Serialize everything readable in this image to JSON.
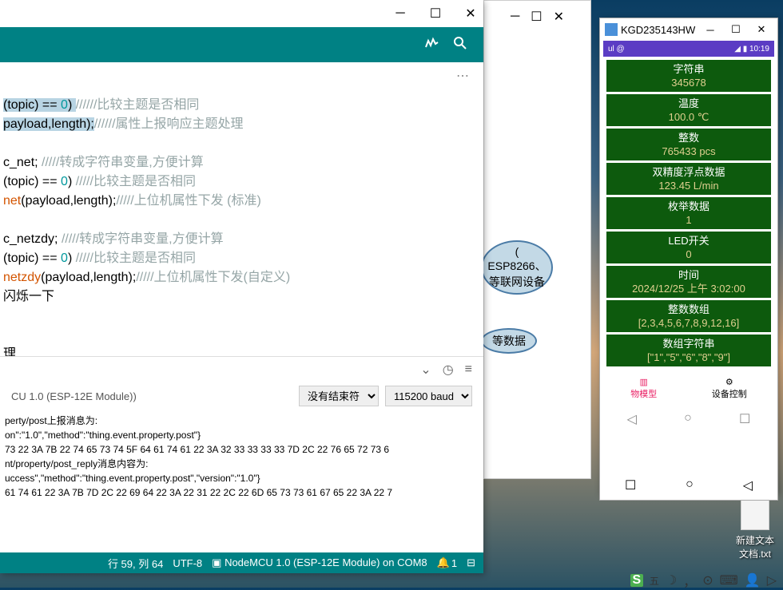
{
  "arduino": {
    "code": {
      "l1_a": "(topic) == ",
      "l1_b": "0",
      "l1_c": ") ",
      "l1_d": "//////比较主题是否相同",
      "l2_a": "payload,length);",
      "l2_b": "//////属性上报响应主题处理",
      "l4_a": "c_net;          ",
      "l4_b": "/////转成字符串变量,方便计算",
      "l5_a": "(topic) == ",
      "l5_b": "0",
      "l5_c": ") ",
      "l5_d": "/////比较主题是否相同",
      "l6_a": "net",
      "l6_b": "(payload,length);",
      "l6_c": "/////上位机属性下发 (标准)",
      "l8_a": "c_netzdy; ",
      "l8_b": "/////转成字符串变量,方便计算",
      "l9_a": "(topic) == ",
      "l9_b": "0",
      "l9_c": ") ",
      "l9_d": "/////比较主题是否相同",
      "l10_a": "netzdy",
      "l10_b": "(payload,length);",
      "l10_c": "/////上位机属性下发(自定义)",
      "l11": "闪烁一下",
      "l13": "理"
    },
    "serial": {
      "module_label": "CU 1.0 (ESP-12E Module))",
      "terminator_label": "没有结束符",
      "baud_label": "115200 baud",
      "lines": [
        "perty/post上报消息为:",
        "on\":\"1.0\",\"method\":\"thing.event.property.post\"}",
        "73 22 3A 7B 22 74 65 73 74 5F 64 61 74 61 22 3A 32 33 33 33 33 7D 2C 22 76 65 72 73 6",
        "nt/property/post_reply消息内容为:",
        "uccess\",\"method\":\"thing.event.property.post\",\"version\":\"1.0\"}",
        "61 74 61 22 3A 7B 7D 2C 22 69 64 22 3A 22 31 22 2C 22 6D 65 73 73 61 67 65 22 3A 22 7"
      ]
    },
    "status": {
      "line_col": "行 59, 列 64",
      "encoding": "UTF-8",
      "board": "NodeMCU 1.0 (ESP-12E Module) on COM8",
      "notif": "1"
    }
  },
  "diagram": {
    "box1_l1": "( ESP8266、",
    "box1_l2": "等联网设备",
    "box2": "等数据"
  },
  "android": {
    "window_title": "KGD235143HW",
    "status_left": "ul @",
    "status_right": "◢ ▮ 10:19",
    "cards": [
      {
        "label": "字符串",
        "value": "345678"
      },
      {
        "label": "温度",
        "value": "100.0 ℃"
      },
      {
        "label": "整数",
        "value": "765433 pcs"
      },
      {
        "label": "双精度浮点数据",
        "value": "123.45 L/min"
      },
      {
        "label": "枚举数据",
        "value": "1"
      },
      {
        "label": "LED开关",
        "value": "0"
      },
      {
        "label": "时间",
        "value": "2024/12/25 上午 3:02:00"
      },
      {
        "label": "整数数组",
        "value": "[2,3,4,5,6,7,8,9,12,16]"
      },
      {
        "label": "数组字符串",
        "value": "[\"1\",\"5\",\"6\",\"8\",\"9\"]"
      }
    ],
    "tabs": {
      "model": "物模型",
      "control": "设备控制"
    }
  },
  "desktop": {
    "file_name": "新建文本文档.txt"
  },
  "taskbar": {
    "ime": "五"
  }
}
